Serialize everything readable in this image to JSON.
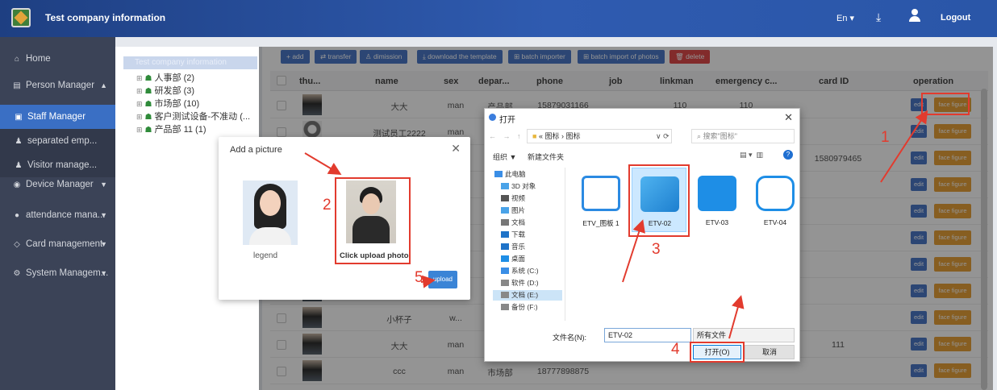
{
  "app": {
    "title": "Test company information",
    "lang": "En",
    "logout": "Logout"
  },
  "sidebar": {
    "items": [
      {
        "icon": "home-icon",
        "label": "Home"
      },
      {
        "icon": "person-manager-icon",
        "label": "Person Manager"
      },
      {
        "icon": "staff-icon",
        "label": "Staff Manager"
      },
      {
        "icon": "separated-icon",
        "label": "separated emp..."
      },
      {
        "icon": "visitor-icon",
        "label": "Visitor manage..."
      },
      {
        "icon": "device-icon",
        "label": "Device Manager"
      },
      {
        "icon": "attendance-icon",
        "label": "attendance mana..."
      },
      {
        "icon": "card-icon",
        "label": "Card management"
      },
      {
        "icon": "system-icon",
        "label": "System Managem..."
      }
    ]
  },
  "tree": {
    "root": "Test company information",
    "nodes": [
      "人事部 (2)",
      "研发部 (3)",
      "市场部 (10)",
      "客户测试设备-不准动 (...",
      "产品部 11 (1)"
    ]
  },
  "toolbar": {
    "buttons": [
      "add",
      "transfer",
      "dimission",
      "download the template",
      "batch importer",
      "batch import of photos",
      "delete"
    ]
  },
  "table": {
    "headers": [
      "thu...",
      "name",
      "sex",
      "depar...",
      "phone",
      "job",
      "linkman",
      "emergency c...",
      "card ID",
      "operation"
    ],
    "rows": [
      {
        "name": "大大",
        "sex": "man",
        "dept": "产品部",
        "phone": "15879031166",
        "job": "",
        "linkman": "110",
        "emergency": "110",
        "card": ""
      },
      {
        "name": "测试员工2222",
        "sex": "man",
        "dept": "",
        "phone": "",
        "job": "",
        "linkman": "",
        "emergency": "",
        "card": ""
      },
      {
        "name": "",
        "sex": "",
        "dept": "",
        "phone": "",
        "job": "",
        "linkman": "",
        "emergency": "",
        "card": "1580979465"
      },
      {
        "name": "",
        "sex": "",
        "dept": "",
        "phone": "",
        "job": "",
        "linkman": "",
        "emergency": "",
        "card": ""
      },
      {
        "name": "",
        "sex": "",
        "dept": "",
        "phone": "",
        "job": "",
        "linkman": "",
        "emergency": "",
        "card": ""
      },
      {
        "name": "",
        "sex": "",
        "dept": "",
        "phone": "",
        "job": "",
        "linkman": "",
        "emergency": "",
        "card": ""
      },
      {
        "name": "",
        "sex": "",
        "dept": "",
        "phone": "",
        "job": "",
        "linkman": "",
        "emergency": "",
        "card": ""
      },
      {
        "name": "",
        "sex": "",
        "dept": "",
        "phone": "",
        "job": "",
        "linkman": "",
        "emergency": "",
        "card": ""
      },
      {
        "name": "小杯子",
        "sex": "w...",
        "dept": "",
        "phone": "",
        "job": "",
        "linkman": "",
        "emergency": "",
        "card": ""
      },
      {
        "name": "大大",
        "sex": "man",
        "dept": "",
        "phone": "",
        "job": "",
        "linkman": "",
        "emergency": "",
        "card": "111"
      },
      {
        "name": "ccc",
        "sex": "man",
        "dept": "市场部",
        "phone": "18777898875",
        "job": "",
        "linkman": "",
        "emergency": "",
        "card": ""
      }
    ],
    "edit_label": "edit",
    "face_label": "face figure"
  },
  "add_picture": {
    "title": "Add a picture",
    "legend_label": "legend",
    "upload_label": "Click upload photo",
    "upload_button": "upload"
  },
  "file_dialog": {
    "title": "打开",
    "path": "« 图标 › 图标",
    "search_placeholder": "搜索\"图标\"",
    "organize": "组织 ▼",
    "new_folder": "新建文件夹",
    "tree": [
      "此电脑",
      "3D 对象",
      "视频",
      "图片",
      "文档",
      "下载",
      "音乐",
      "桌面",
      "系统 (C:)",
      "软件 (D:)",
      "文档 (E:)",
      "备份 (F:)"
    ],
    "files": [
      "ETV_图板 1",
      "ETV-02",
      "ETV-03",
      "ETV-04"
    ],
    "filename_label": "文件名(N):",
    "filename_value": "ETV-02",
    "filetype": "所有文件",
    "open_button": "打开(O)",
    "cancel_button": "取消"
  },
  "steps": [
    "1",
    "2",
    "3",
    "4",
    "5"
  ],
  "colors": {
    "topbar": "#2a56a8",
    "sidebar": "#3b4357",
    "active": "#3a6fc4",
    "annotation": "#e23b2e",
    "face_button": "#e8a23a",
    "edit_button": "#4c79c9"
  }
}
